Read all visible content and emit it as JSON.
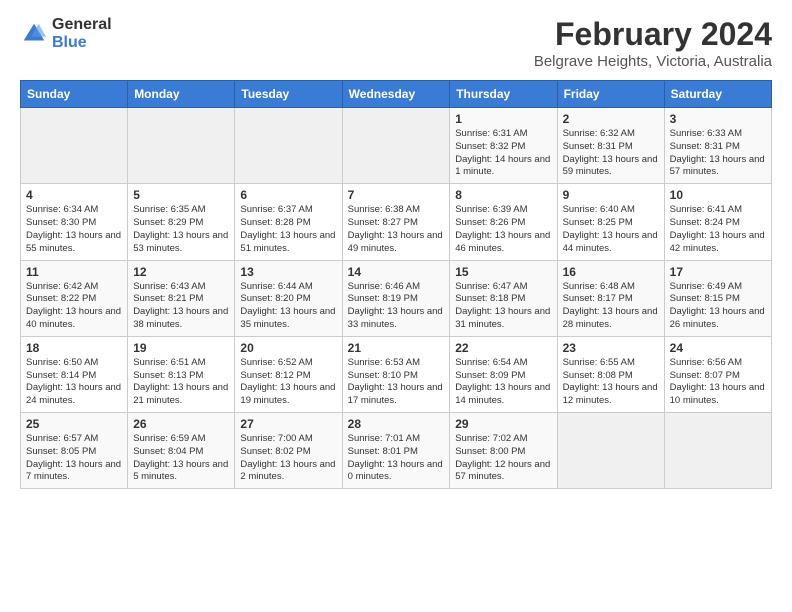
{
  "header": {
    "logo_general": "General",
    "logo_blue": "Blue",
    "main_title": "February 2024",
    "subtitle": "Belgrave Heights, Victoria, Australia"
  },
  "calendar": {
    "days_of_week": [
      "Sunday",
      "Monday",
      "Tuesday",
      "Wednesday",
      "Thursday",
      "Friday",
      "Saturday"
    ],
    "weeks": [
      [
        {
          "day": "",
          "info": ""
        },
        {
          "day": "",
          "info": ""
        },
        {
          "day": "",
          "info": ""
        },
        {
          "day": "",
          "info": ""
        },
        {
          "day": "1",
          "info": "Sunrise: 6:31 AM\nSunset: 8:32 PM\nDaylight: 14 hours and 1 minute."
        },
        {
          "day": "2",
          "info": "Sunrise: 6:32 AM\nSunset: 8:31 PM\nDaylight: 13 hours and 59 minutes."
        },
        {
          "day": "3",
          "info": "Sunrise: 6:33 AM\nSunset: 8:31 PM\nDaylight: 13 hours and 57 minutes."
        }
      ],
      [
        {
          "day": "4",
          "info": "Sunrise: 6:34 AM\nSunset: 8:30 PM\nDaylight: 13 hours and 55 minutes."
        },
        {
          "day": "5",
          "info": "Sunrise: 6:35 AM\nSunset: 8:29 PM\nDaylight: 13 hours and 53 minutes."
        },
        {
          "day": "6",
          "info": "Sunrise: 6:37 AM\nSunset: 8:28 PM\nDaylight: 13 hours and 51 minutes."
        },
        {
          "day": "7",
          "info": "Sunrise: 6:38 AM\nSunset: 8:27 PM\nDaylight: 13 hours and 49 minutes."
        },
        {
          "day": "8",
          "info": "Sunrise: 6:39 AM\nSunset: 8:26 PM\nDaylight: 13 hours and 46 minutes."
        },
        {
          "day": "9",
          "info": "Sunrise: 6:40 AM\nSunset: 8:25 PM\nDaylight: 13 hours and 44 minutes."
        },
        {
          "day": "10",
          "info": "Sunrise: 6:41 AM\nSunset: 8:24 PM\nDaylight: 13 hours and 42 minutes."
        }
      ],
      [
        {
          "day": "11",
          "info": "Sunrise: 6:42 AM\nSunset: 8:22 PM\nDaylight: 13 hours and 40 minutes."
        },
        {
          "day": "12",
          "info": "Sunrise: 6:43 AM\nSunset: 8:21 PM\nDaylight: 13 hours and 38 minutes."
        },
        {
          "day": "13",
          "info": "Sunrise: 6:44 AM\nSunset: 8:20 PM\nDaylight: 13 hours and 35 minutes."
        },
        {
          "day": "14",
          "info": "Sunrise: 6:46 AM\nSunset: 8:19 PM\nDaylight: 13 hours and 33 minutes."
        },
        {
          "day": "15",
          "info": "Sunrise: 6:47 AM\nSunset: 8:18 PM\nDaylight: 13 hours and 31 minutes."
        },
        {
          "day": "16",
          "info": "Sunrise: 6:48 AM\nSunset: 8:17 PM\nDaylight: 13 hours and 28 minutes."
        },
        {
          "day": "17",
          "info": "Sunrise: 6:49 AM\nSunset: 8:15 PM\nDaylight: 13 hours and 26 minutes."
        }
      ],
      [
        {
          "day": "18",
          "info": "Sunrise: 6:50 AM\nSunset: 8:14 PM\nDaylight: 13 hours and 24 minutes."
        },
        {
          "day": "19",
          "info": "Sunrise: 6:51 AM\nSunset: 8:13 PM\nDaylight: 13 hours and 21 minutes."
        },
        {
          "day": "20",
          "info": "Sunrise: 6:52 AM\nSunset: 8:12 PM\nDaylight: 13 hours and 19 minutes."
        },
        {
          "day": "21",
          "info": "Sunrise: 6:53 AM\nSunset: 8:10 PM\nDaylight: 13 hours and 17 minutes."
        },
        {
          "day": "22",
          "info": "Sunrise: 6:54 AM\nSunset: 8:09 PM\nDaylight: 13 hours and 14 minutes."
        },
        {
          "day": "23",
          "info": "Sunrise: 6:55 AM\nSunset: 8:08 PM\nDaylight: 13 hours and 12 minutes."
        },
        {
          "day": "24",
          "info": "Sunrise: 6:56 AM\nSunset: 8:07 PM\nDaylight: 13 hours and 10 minutes."
        }
      ],
      [
        {
          "day": "25",
          "info": "Sunrise: 6:57 AM\nSunset: 8:05 PM\nDaylight: 13 hours and 7 minutes."
        },
        {
          "day": "26",
          "info": "Sunrise: 6:59 AM\nSunset: 8:04 PM\nDaylight: 13 hours and 5 minutes."
        },
        {
          "day": "27",
          "info": "Sunrise: 7:00 AM\nSunset: 8:02 PM\nDaylight: 13 hours and 2 minutes."
        },
        {
          "day": "28",
          "info": "Sunrise: 7:01 AM\nSunset: 8:01 PM\nDaylight: 13 hours and 0 minutes."
        },
        {
          "day": "29",
          "info": "Sunrise: 7:02 AM\nSunset: 8:00 PM\nDaylight: 12 hours and 57 minutes."
        },
        {
          "day": "",
          "info": ""
        },
        {
          "day": "",
          "info": ""
        }
      ]
    ]
  }
}
